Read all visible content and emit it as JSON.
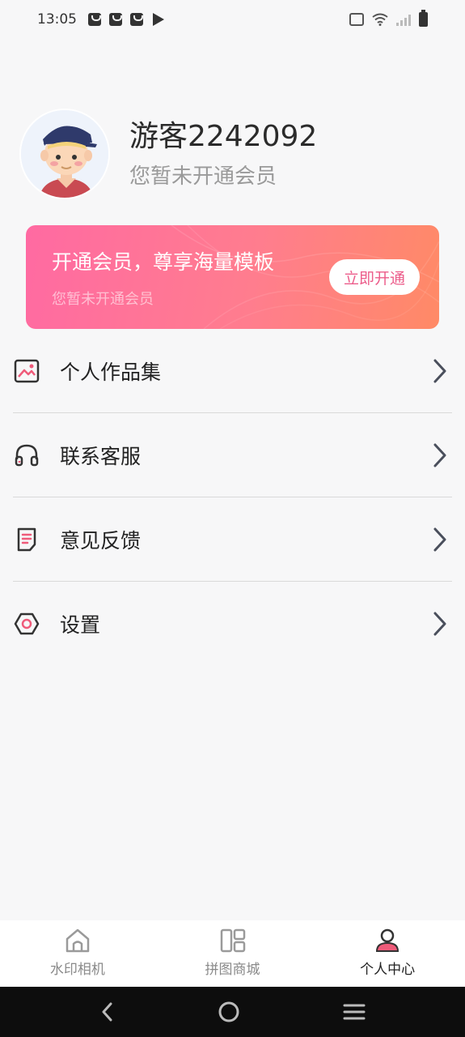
{
  "status_bar": {
    "time": "13:05",
    "icons": [
      "bag-notification-icon",
      "bag-notification-icon",
      "bag-notification-icon",
      "play-store-icon",
      "vibrate-icon",
      "wifi-icon",
      "signal-icon",
      "battery-icon"
    ]
  },
  "profile": {
    "name": "游客2242092",
    "member_status": "您暂未开通会员"
  },
  "vip_card": {
    "title": "开通会员，尊享海量模板",
    "subtitle": "您暂未开通会员",
    "button_label": "立即开通",
    "colors": {
      "gradient_start": "#ff6aa2",
      "gradient_end": "#ff8a66",
      "button_text": "#ec5d8b"
    }
  },
  "menu": {
    "items": [
      {
        "label": "个人作品集",
        "icon": "gallery-icon"
      },
      {
        "label": "联系客服",
        "icon": "headphones-icon"
      },
      {
        "label": "意见反馈",
        "icon": "feedback-icon"
      },
      {
        "label": "设置",
        "icon": "settings-hexagon-icon"
      }
    ]
  },
  "tab_bar": {
    "tabs": [
      {
        "label": "水印相机",
        "icon": "home-icon",
        "active": false
      },
      {
        "label": "拼图商城",
        "icon": "grid-icon",
        "active": false
      },
      {
        "label": "个人中心",
        "icon": "user-icon",
        "active": true
      }
    ]
  },
  "nav_bar": {
    "icons": [
      "back-icon",
      "home-circle-icon",
      "menu-lines-icon"
    ]
  },
  "colors": {
    "accent": "#ef5b7a",
    "background": "#f7f7f8"
  }
}
